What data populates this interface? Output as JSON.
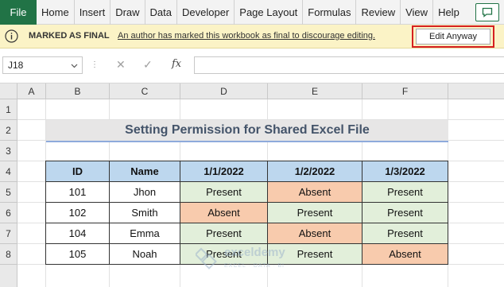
{
  "ribbon": {
    "file_label": "File",
    "tabs": [
      "Home",
      "Insert",
      "Draw",
      "Data",
      "Developer",
      "Page Layout",
      "Formulas",
      "Review",
      "View",
      "Help"
    ],
    "comment_icon": "comment-icon"
  },
  "message_bar": {
    "icon": "info-icon",
    "title": "MARKED AS FINAL",
    "text": "An author has marked this workbook as final to discourage editing.",
    "button_label": "Edit Anyway"
  },
  "formula_bar": {
    "name_box": "J18",
    "cancel_symbol": "✕",
    "confirm_symbol": "✓",
    "fx_symbol": "fx",
    "value": ""
  },
  "grid": {
    "columns": [
      "A",
      "B",
      "C",
      "D",
      "E",
      "F"
    ],
    "rows": [
      "1",
      "2",
      "3",
      "4",
      "5",
      "6",
      "7",
      "8"
    ],
    "title": "Setting Permission for Shared Excel File",
    "table": {
      "headers": [
        "ID",
        "Name",
        "1/1/2022",
        "1/2/2022",
        "1/3/2022"
      ],
      "rows": [
        [
          "101",
          "Jhon",
          "Present",
          "Absent",
          "Present"
        ],
        [
          "102",
          "Smith",
          "Absent",
          "Present",
          "Present"
        ],
        [
          "104",
          "Emma",
          "Present",
          "Absent",
          "Present"
        ],
        [
          "105",
          "Noah",
          "Present",
          "Present",
          "Absent"
        ]
      ]
    }
  },
  "watermark": {
    "name": "exceldemy",
    "tagline": "EXCEL · DATA · BI"
  },
  "colors": {
    "excel_green": "#217346",
    "message_bar": "#fbf3c6",
    "highlight_border": "#d62020",
    "header_fill": "#bdd7ee",
    "present_fill": "#e2efda",
    "absent_fill": "#f8cbad",
    "title_fill": "#e7e6e6",
    "title_text": "#44546a"
  }
}
